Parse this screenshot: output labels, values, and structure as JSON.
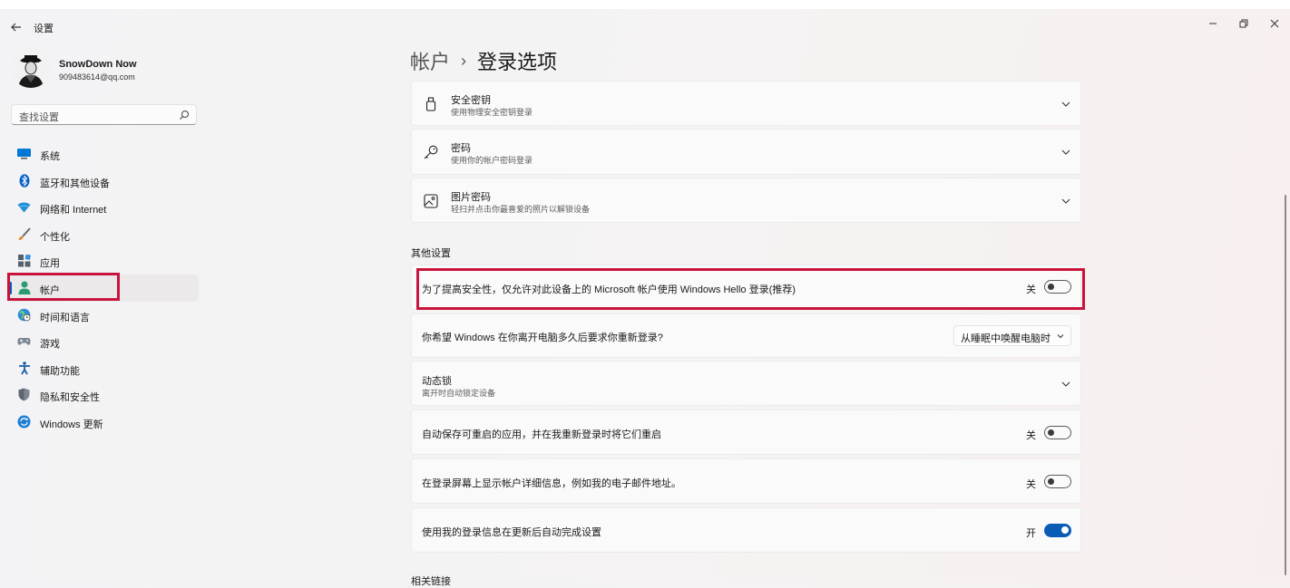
{
  "window": {
    "title": "设置",
    "minimize_glyph": "—",
    "restore_glyph": "❐",
    "close_glyph": "✕"
  },
  "profile": {
    "name": "SnowDown Now",
    "email": "909483614@qq.com"
  },
  "search": {
    "placeholder": "查找设置"
  },
  "sidebar": {
    "items": [
      {
        "label": "系统",
        "icon": "system-icon",
        "selected": false
      },
      {
        "label": "蓝牙和其他设备",
        "icon": "bluetooth-icon",
        "selected": false
      },
      {
        "label": "网络和 Internet",
        "icon": "wifi-icon",
        "selected": false
      },
      {
        "label": "个性化",
        "icon": "brush-icon",
        "selected": false
      },
      {
        "label": "应用",
        "icon": "apps-icon",
        "selected": false
      },
      {
        "label": "帐户",
        "icon": "account-icon",
        "selected": true
      },
      {
        "label": "时间和语言",
        "icon": "globe-clock-icon",
        "selected": false
      },
      {
        "label": "游戏",
        "icon": "gamepad-icon",
        "selected": false
      },
      {
        "label": "辅助功能",
        "icon": "accessibility-icon",
        "selected": false
      },
      {
        "label": "隐私和安全性",
        "icon": "shield-icon",
        "selected": false
      },
      {
        "label": "Windows 更新",
        "icon": "update-icon",
        "selected": false
      }
    ]
  },
  "breadcrumb": {
    "parent": "帐户",
    "separator": "›",
    "current": "登录选项"
  },
  "sign_in_methods": [
    {
      "title": "安全密钥",
      "subtitle": "使用物理安全密钥登录",
      "icon": "security-key-icon"
    },
    {
      "title": "密码",
      "subtitle": "使用你的帐户密码登录",
      "icon": "key-icon"
    },
    {
      "title": "图片密码",
      "subtitle": "轻扫并点击你最喜爱的照片以解锁设备",
      "icon": "picture-icon"
    }
  ],
  "other_settings": {
    "section_title": "其他设置",
    "hello_only": {
      "label": "为了提高安全性，仅允许对此设备上的 Microsoft 帐户使用 Windows Hello 登录(推荐)",
      "state_text": "关",
      "on": false
    },
    "require_signin": {
      "label": "你希望 Windows 在你离开电脑多久后要求你重新登录?",
      "selected": "从睡眠中唤醒电脑时"
    },
    "dynamic_lock": {
      "title": "动态锁",
      "subtitle": "离开时自动锁定设备"
    },
    "restart_apps": {
      "label": "自动保存可重启的应用，并在我重新登录时将它们重启",
      "state_text": "关",
      "on": false
    },
    "show_account_details": {
      "label": "在登录屏幕上显示帐户详细信息，例如我的电子邮件地址。",
      "state_text": "关",
      "on": false
    },
    "use_signin_info": {
      "label": "使用我的登录信息在更新后自动完成设置",
      "state_text": "开",
      "on": true
    }
  },
  "related_links": {
    "section_title": "相关链接"
  },
  "colors": {
    "accent": "#0a5bb5",
    "highlight_box": "#c8143c"
  }
}
